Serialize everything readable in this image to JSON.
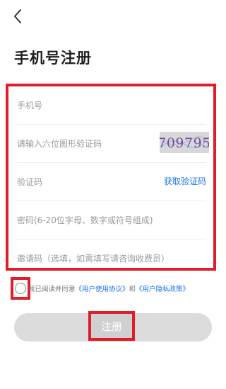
{
  "header": {
    "back_icon": "chevron-left-icon"
  },
  "page": {
    "title": "手机号注册"
  },
  "form": {
    "phone_placeholder": "手机号",
    "captcha_placeholder": "请输入六位图形验证码",
    "captcha_code": "709795",
    "sms_placeholder": "验证码",
    "get_code_label": "获取验证码",
    "password_placeholder": "密码(6-20位字母、数字或符号组成)",
    "invite_placeholder": "邀请码（选填，如需填写请咨询收费员）"
  },
  "agreement": {
    "prefix": "我已阅读并同意",
    "user_agreement": "《用户使用协议》",
    "conjunction": "和",
    "privacy_policy": "《用户隐私政策》"
  },
  "register": {
    "label": "注册"
  },
  "colors": {
    "highlight": "#e11d2a",
    "link": "#1a73e8",
    "button_disabled": "#dcdcdc"
  }
}
